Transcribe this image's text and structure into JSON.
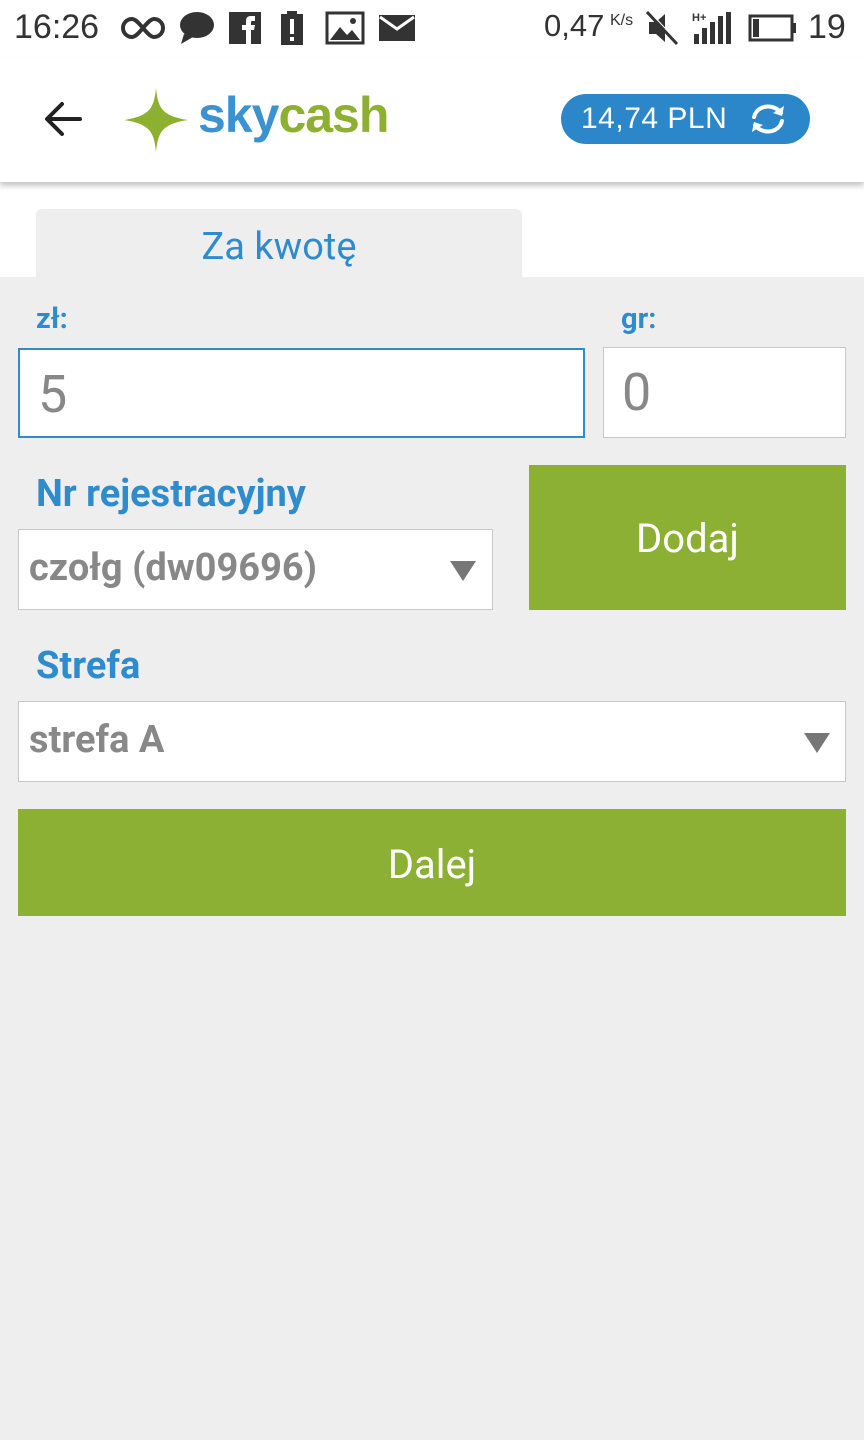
{
  "status_bar": {
    "time": "16:26",
    "net_speed": "0,47",
    "net_speed_unit": "K/s",
    "battery": "19",
    "icons": [
      "infinity-icon",
      "chat-bubble-icon",
      "facebook-icon",
      "alert-icon",
      "image-icon",
      "mail-icon",
      "mute-icon",
      "signal-icon",
      "battery-icon"
    ]
  },
  "app_bar": {
    "logo_part1": "sky",
    "logo_part2": "cash",
    "balance": "14,74 PLN"
  },
  "tabs": [
    {
      "label": "Za kwotę",
      "active": true
    }
  ],
  "form": {
    "zl_label": "zł:",
    "zl_value": "5",
    "gr_label": "gr:",
    "gr_value": "0",
    "plate_label": "Nr rejestracyjny",
    "plate_selected": "czołg (dw09696)",
    "add_button": "Dodaj",
    "zone_label": "Strefa",
    "zone_selected": "strefa A",
    "next_button": "Dalej"
  },
  "colors": {
    "brand_blue": "#2e8ccd",
    "brand_green": "#8cb033",
    "balance_pill": "#2b87c9",
    "background": "#eeeeee"
  }
}
